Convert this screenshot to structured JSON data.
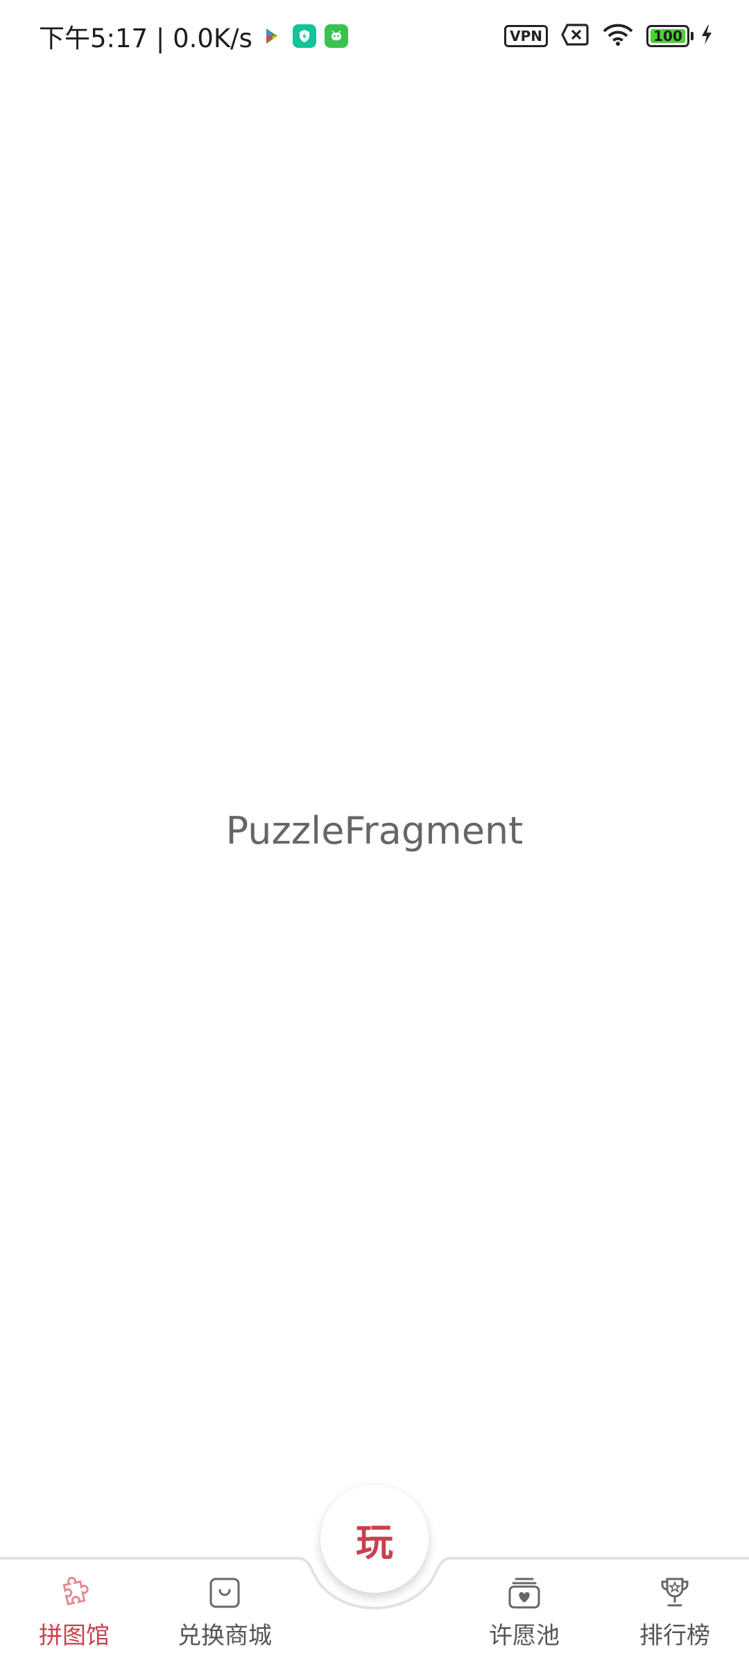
{
  "status_bar": {
    "time_speed": "下午5:17 | 0.0K/s",
    "vpn_label": "VPN",
    "battery_level": "100",
    "icons": [
      "app-store-icon",
      "shield-app-icon",
      "android-app-icon",
      "vpn-icon",
      "no-sim-icon",
      "wifi-icon",
      "battery-icon",
      "charging-icon"
    ]
  },
  "main": {
    "fragment_label": "PuzzleFragment"
  },
  "bottom_nav": {
    "items": [
      {
        "label": "拼图馆",
        "icon": "puzzle-icon",
        "active": true
      },
      {
        "label": "兑换商城",
        "icon": "shopping-bag-icon",
        "active": false
      },
      {
        "label": "许愿池",
        "icon": "wish-heart-icon",
        "active": false
      },
      {
        "label": "排行榜",
        "icon": "trophy-icon",
        "active": false
      }
    ],
    "center_button": {
      "label": "玩"
    }
  },
  "colors": {
    "accent": "#c8414f",
    "inactive": "#555555",
    "text_gray": "#666666",
    "battery_green": "#4cd137"
  }
}
